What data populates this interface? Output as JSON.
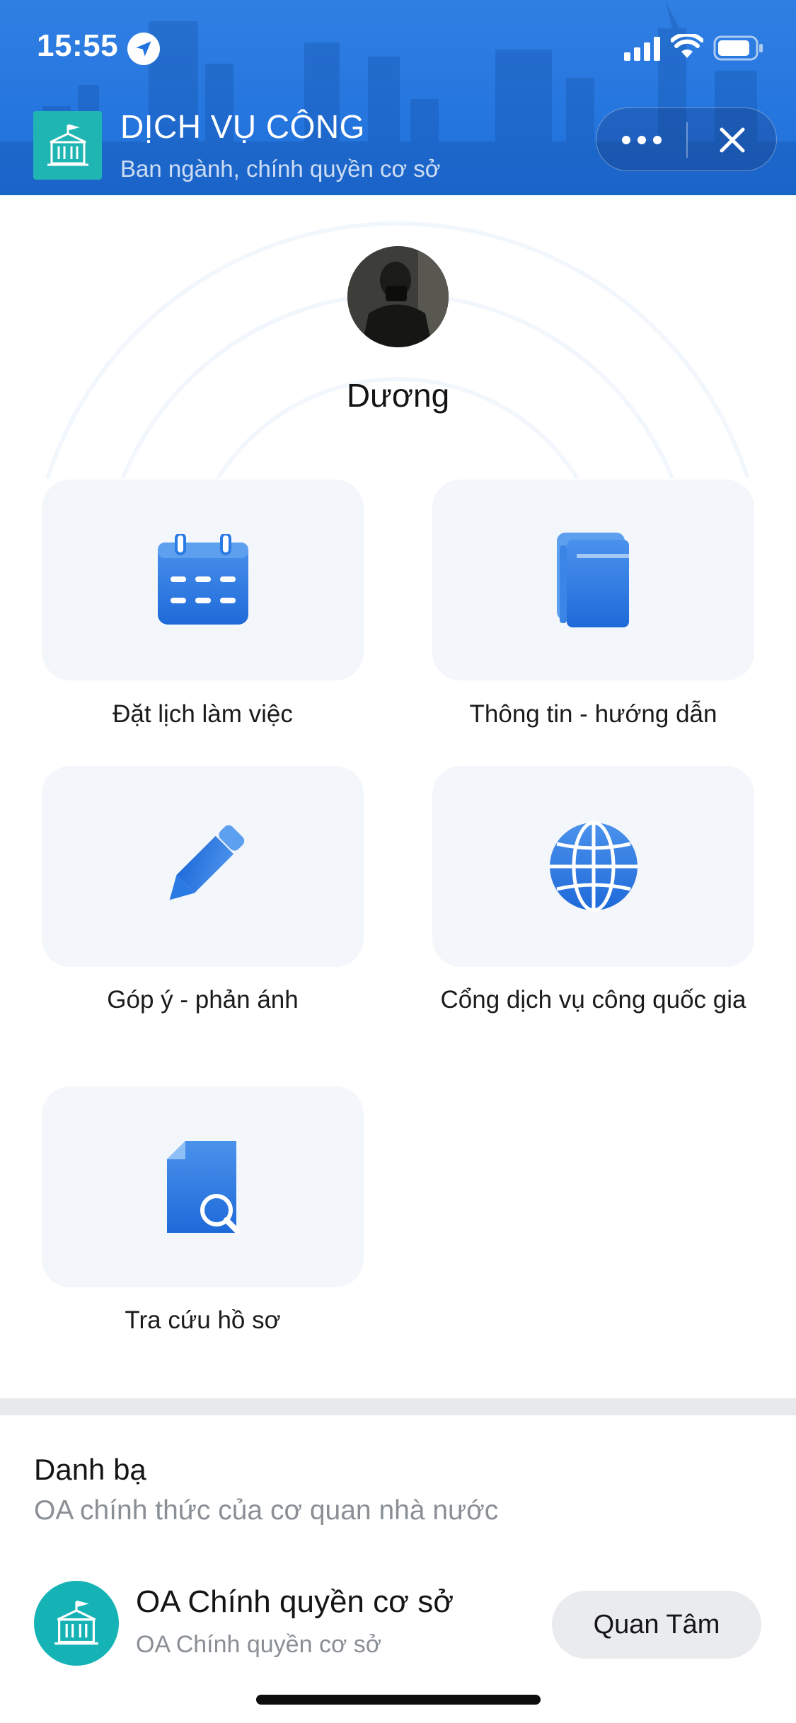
{
  "status_bar": {
    "time": "15:55",
    "icons": [
      "location-arrow-icon",
      "signal-icon",
      "wifi-icon",
      "battery-icon"
    ]
  },
  "header": {
    "title": "DỊCH VỤ CÔNG",
    "subtitle": "Ban ngành, chính quyền cơ sở",
    "logo_icon": "government-building-icon",
    "more_icon": "more-dots-icon",
    "close_icon": "close-icon",
    "brand_color": "#2174de"
  },
  "profile": {
    "name": "Dương"
  },
  "services": [
    {
      "label": "Đặt lịch làm việc",
      "icon": "calendar-icon"
    },
    {
      "label": "Thông tin - hướng dẫn",
      "icon": "book-icon"
    },
    {
      "label": "Góp ý - phản ánh",
      "icon": "pencil-icon"
    },
    {
      "label": "Cổng dịch vụ công quốc gia",
      "icon": "globe-icon"
    },
    {
      "label": "Tra cứu hồ sơ",
      "icon": "document-search-icon"
    }
  ],
  "contacts": {
    "title": "Danh bạ",
    "subtitle": "OA chính thức của cơ quan nhà nước",
    "items": [
      {
        "name": "OA Chính quyền cơ sở",
        "subtitle": "OA Chính quyền cơ sở",
        "button": "Quan Tâm",
        "icon": "government-building-icon"
      }
    ]
  },
  "colors": {
    "icon_blue": "#2a7ae4",
    "teal": "#16b3b6",
    "tile_bg": "#f3f6fa"
  }
}
